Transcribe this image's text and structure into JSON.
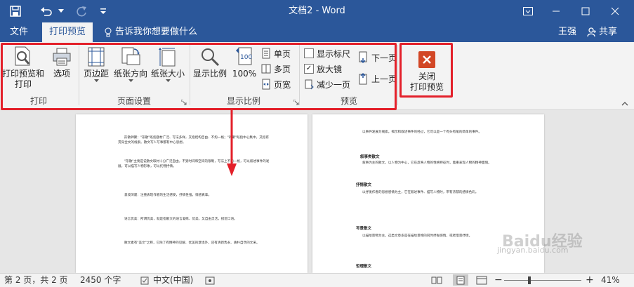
{
  "window": {
    "title": "文档2 - Word"
  },
  "tabs": {
    "file": "文件",
    "print_preview": "打印预览",
    "tell_me": "告诉我你想要做什么",
    "user": "王强",
    "share": "共享"
  },
  "ribbon": {
    "print_group": {
      "label": "打印",
      "print_preview_and_print": "打印预览和\n打印",
      "options": "选项"
    },
    "page_setup_group": {
      "label": "页面设置",
      "margins": "页边距",
      "orientation": "纸张方向",
      "size": "纸张大小"
    },
    "zoom_group": {
      "label": "显示比例",
      "zoom": "显示比例",
      "hundred": "100%",
      "one_page": "单页",
      "multiple_pages": "多页",
      "page_width": "页宽"
    },
    "preview_group": {
      "label": "预览",
      "show_ruler": "显示标尺",
      "magnifier": "放大镜",
      "shrink_one_page": "减少一页",
      "next_page": "下一页",
      "prev_page": "上一页"
    },
    "close_group": {
      "close_preview": "关闭\n打印预览"
    }
  },
  "document": {
    "page1_paras": [
      "形散神聚：\"形散\"既指题材广泛、写法多样，又指结构自由、不拘一格；\"神聚\"既指中心集中，又指有贯穿全文的线索。散文写人写事都有中心思想。",
      "\"形散\"主要是说散文取材十分广泛自由，不受时间和空间的限制，写法上不拘一格，可以叙述事件的发展，可以描写人物形象，可以托物抒情。",
      "意境深邃：注重表现作者的生活感受，抒情性强，情感真挚。",
      "语言优美：所谓优美，就是指散文的语言凝练、优美，又自由灵活，接近口语。",
      "散文素有\"美文\"之称，它除了有精神的见解、优美的意境外，还有清新隽永、质朴自然的文采。"
    ],
    "page2_paras": [
      "以事件发展为线索。揭示和叙述事件的经过，它可以是一个有头有尾的简单的事件。",
      "叙事为主的散文，以人物为中心，它在反映人物的性格特征时，着重表现人物的精神面貌。",
      "以抒发作者的思想感情为主，它在叙述事件、描写人物时，带有浓郁的感情色彩。",
      "以描绘景物为主，这类文章多是在描绘景物的同时抒发感情，或者借景抒情。"
    ],
    "page2_headings": [
      "抒情散文",
      "写景散文",
      "哲理散文"
    ],
    "page2_subheading": "叙事类散文"
  },
  "status": {
    "page": "第 2 页，共 2 页",
    "words": "2450 个字",
    "language": "中文(中国)",
    "zoom": "41%"
  },
  "watermark": {
    "text": "Baidu经验",
    "url": "jingyan.baidu.com"
  },
  "colors": {
    "brand": "#2b579a",
    "highlight": "#e3202a",
    "close_icon": "#d24726"
  }
}
